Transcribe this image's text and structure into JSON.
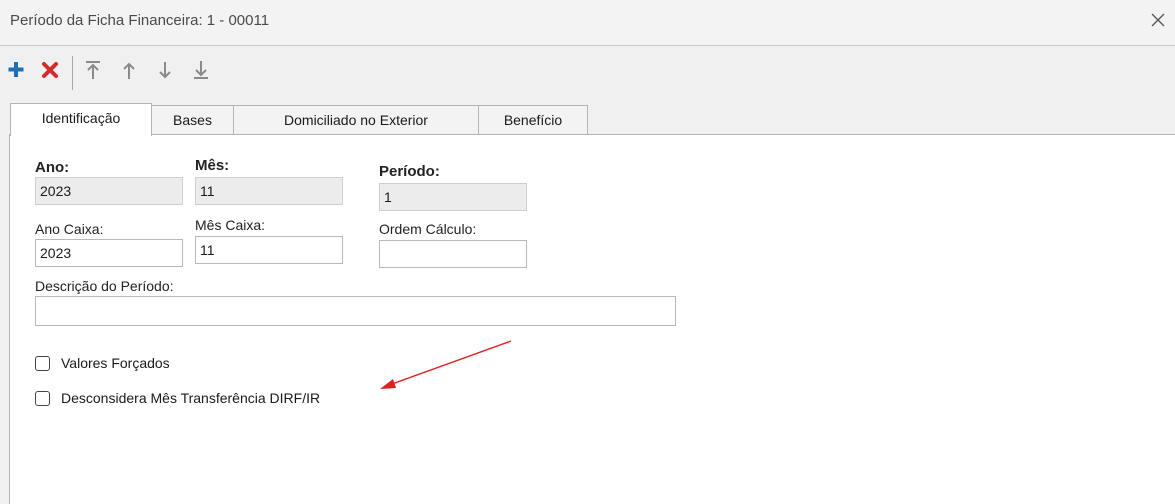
{
  "window": {
    "title": "Período da Ficha Financeira: 1 - 00011"
  },
  "toolbar": {
    "icons": [
      "add-icon",
      "delete-icon",
      "move-first-icon",
      "move-up-icon",
      "move-down-icon",
      "move-last-icon"
    ],
    "colors": {
      "add": "#1f6fb2",
      "delete": "#d12b2b",
      "arrows": "#8a8a8a"
    }
  },
  "tabs": [
    {
      "label": "Identificação",
      "active": true
    },
    {
      "label": "Bases",
      "active": false
    },
    {
      "label": "Domiciliado no Exterior",
      "active": false
    },
    {
      "label": "Benefício",
      "active": false
    }
  ],
  "form": {
    "ano": {
      "label": "Ano:",
      "value": "2023"
    },
    "mes": {
      "label": "Mês:",
      "value": "11"
    },
    "periodo": {
      "label": "Período:",
      "value": "1"
    },
    "ano_caixa": {
      "label": "Ano Caixa:",
      "value": "2023"
    },
    "mes_caixa": {
      "label": "Mês Caixa:",
      "value": "11"
    },
    "ordem_calculo": {
      "label": "Ordem Cálculo:",
      "value": ""
    },
    "descricao": {
      "label": "Descrição do Período:",
      "value": ""
    }
  },
  "checkboxes": {
    "valores_forcados": {
      "label": "Valores Forçados",
      "checked": false
    },
    "desconsidera": {
      "label": "Desconsidera Mês Transferência DIRF/IR",
      "checked": false
    }
  },
  "annotation": {
    "arrow_color": "#e02020"
  }
}
